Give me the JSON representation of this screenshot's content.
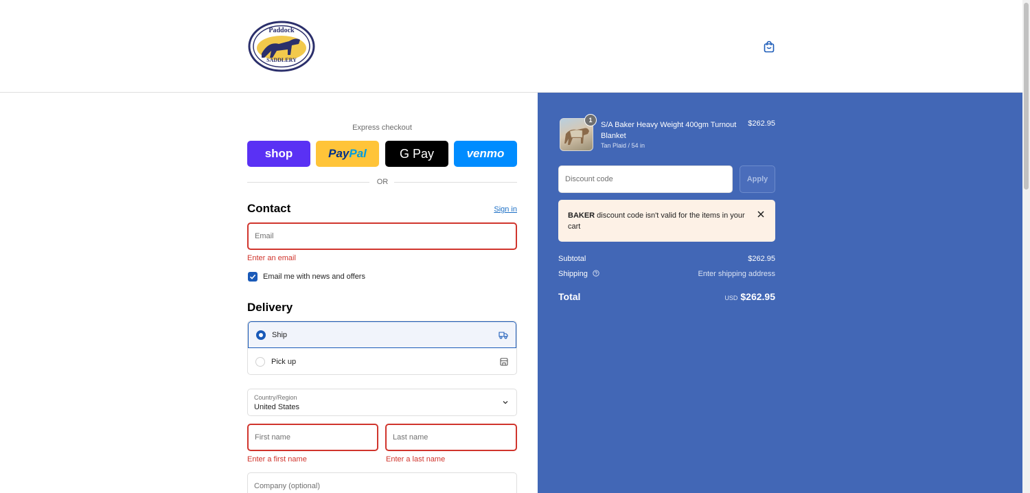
{
  "header": {
    "logo": {
      "top_text": "Paddock",
      "bottom_text": "SADDLERY"
    },
    "cart_icon": "shopping-bag-icon"
  },
  "checkout": {
    "express_label": "Express checkout",
    "express_buttons": {
      "shop": "shop",
      "paypal_pay": "Pay",
      "paypal_pal": "Pal",
      "gpay": "G Pay",
      "venmo": "venmo"
    },
    "or_label": "OR",
    "contact": {
      "title": "Contact",
      "sign_in": "Sign in",
      "email_placeholder": "Email",
      "email_error": "Enter an email",
      "newsletter_label": "Email me with news and offers",
      "newsletter_checked": true
    },
    "delivery": {
      "title": "Delivery",
      "options": [
        {
          "label": "Ship",
          "selected": true,
          "icon": "truck-icon"
        },
        {
          "label": "Pick up",
          "selected": false,
          "icon": "store-icon"
        }
      ],
      "country_label": "Country/Region",
      "country_value": "United States",
      "first_name_placeholder": "First name",
      "first_name_error": "Enter a first name",
      "last_name_placeholder": "Last name",
      "last_name_error": "Enter a last name",
      "company_placeholder": "Company (optional)"
    }
  },
  "summary": {
    "item": {
      "quantity": "1",
      "name": "S/A Baker Heavy Weight 400gm Turnout Blanket",
      "variant": "Tan Plaid / 54 in",
      "price": "$262.95"
    },
    "discount_placeholder": "Discount code",
    "apply_label": "Apply",
    "notice": {
      "code": "BAKER",
      "message": " discount code isn't valid for the items in your cart"
    },
    "subtotal_label": "Subtotal",
    "subtotal_value": "$262.95",
    "shipping_label": "Shipping",
    "shipping_value": "Enter shipping address",
    "total_label": "Total",
    "total_currency": "USD",
    "total_value": "$262.95"
  },
  "colors": {
    "summary_bg": "#4267b6",
    "accent": "#1a5ab8",
    "error": "#d0342c",
    "notice_bg": "#fdf1e6"
  }
}
